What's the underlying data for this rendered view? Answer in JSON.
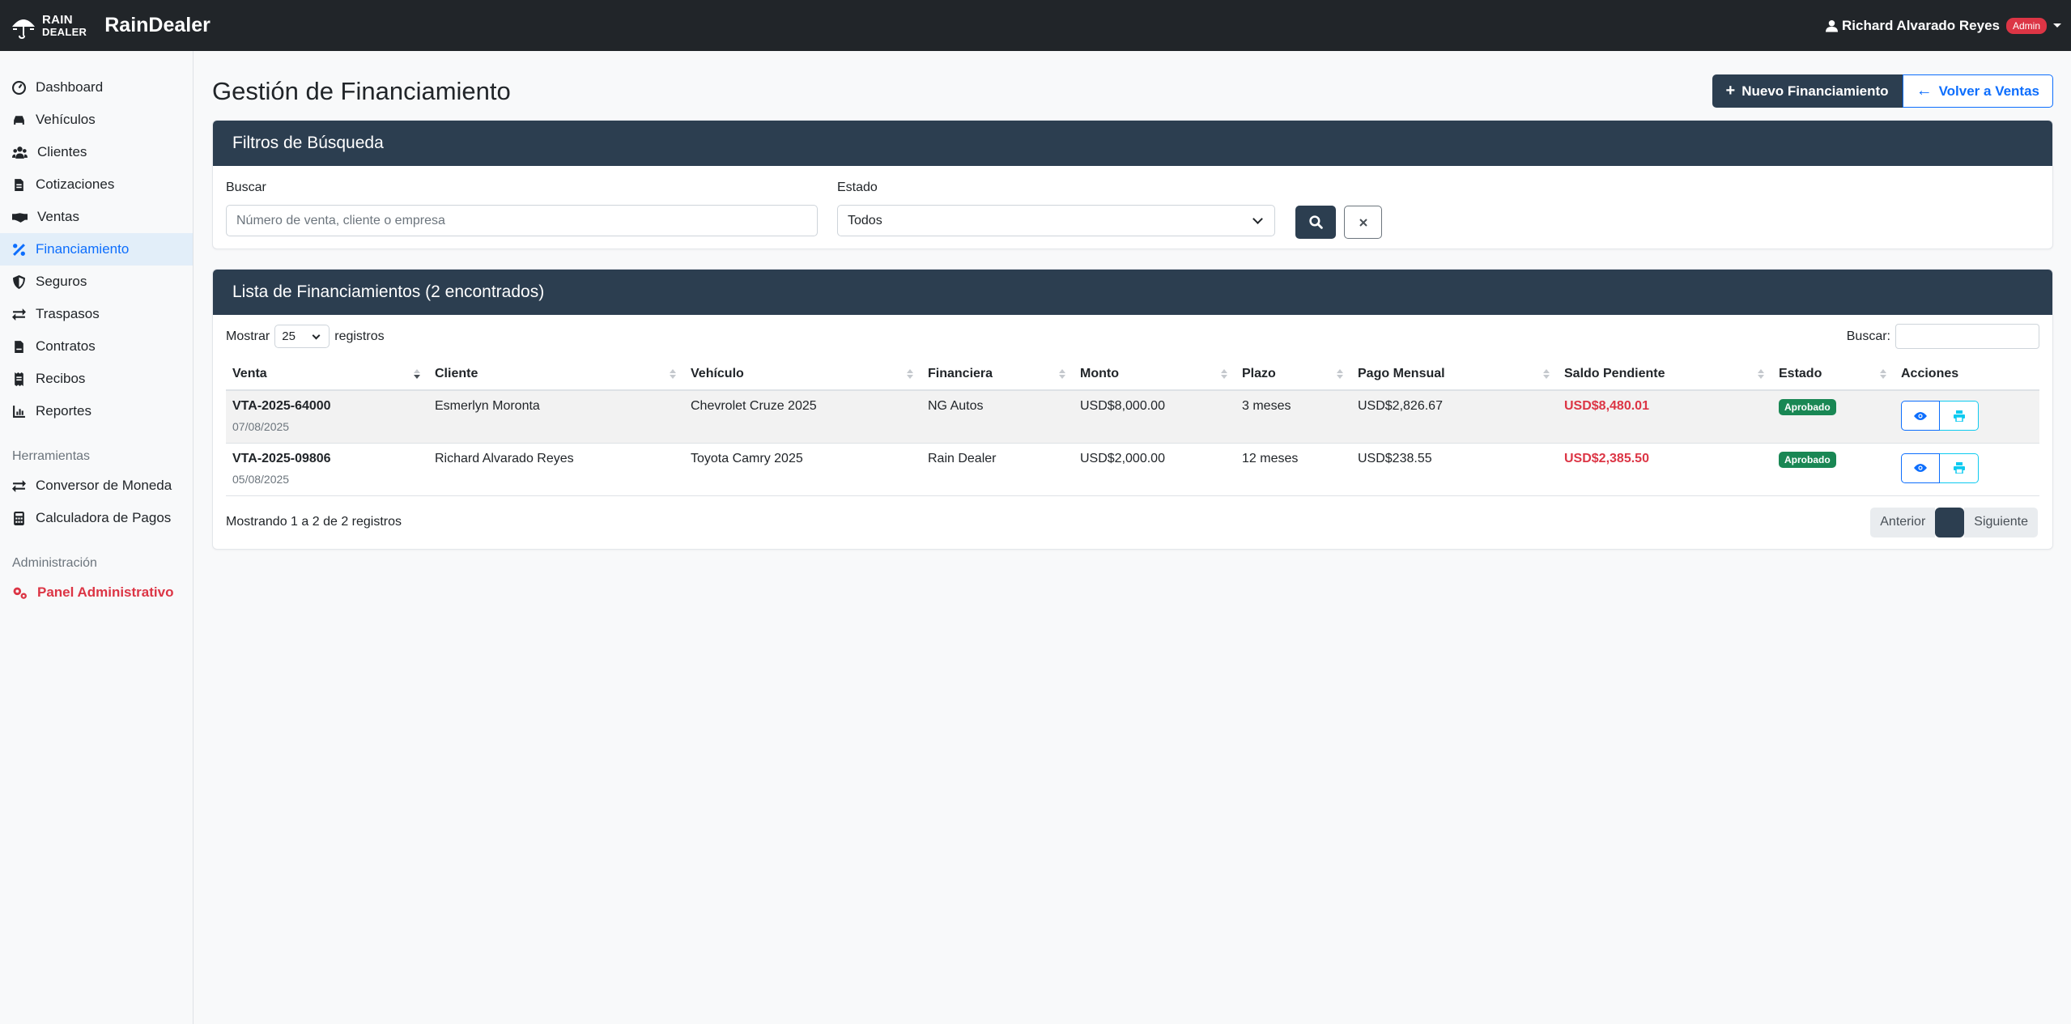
{
  "app": {
    "logo_line1": "RAIN",
    "logo_line2": "DEALER",
    "brand": "RainDealer",
    "user_name": "Richard Alvarado Reyes",
    "user_role": "Admin"
  },
  "sidebar": {
    "items": [
      {
        "label": "Dashboard",
        "icon": "dashboard-icon"
      },
      {
        "label": "Vehículos",
        "icon": "car-icon"
      },
      {
        "label": "Clientes",
        "icon": "users-icon"
      },
      {
        "label": "Cotizaciones",
        "icon": "file-icon"
      },
      {
        "label": "Ventas",
        "icon": "handshake-icon"
      },
      {
        "label": "Financiamiento",
        "icon": "percent-icon",
        "active": true
      },
      {
        "label": "Seguros",
        "icon": "shield-icon"
      },
      {
        "label": "Traspasos",
        "icon": "exchange-icon"
      },
      {
        "label": "Contratos",
        "icon": "file-contract-icon"
      },
      {
        "label": "Recibos",
        "icon": "receipt-icon"
      },
      {
        "label": "Reportes",
        "icon": "chart-icon"
      }
    ],
    "tools_label": "Herramientas",
    "tools": [
      {
        "label": "Conversor de Moneda",
        "icon": "exchange-icon"
      },
      {
        "label": "Calculadora de Pagos",
        "icon": "calculator-icon"
      }
    ],
    "admin_label": "Administración",
    "admin_item": "Panel Administrativo"
  },
  "header": {
    "title": "Gestión de Financiamiento",
    "new_button": "Nuevo Financiamiento",
    "back_button": "Volver a Ventas"
  },
  "filters": {
    "title": "Filtros de Búsqueda",
    "search_label": "Buscar",
    "search_placeholder": "Número de venta, cliente o empresa",
    "status_label": "Estado",
    "status_value": "Todos"
  },
  "list": {
    "title": "Lista de Financiamientos (2 encontrados)",
    "show_label": "Mostrar",
    "page_size": "25",
    "records_label": "registros",
    "search_label": "Buscar:",
    "columns": [
      "Venta",
      "Cliente",
      "Vehículo",
      "Financiera",
      "Monto",
      "Plazo",
      "Pago Mensual",
      "Saldo Pendiente",
      "Estado",
      "Acciones"
    ],
    "rows": [
      {
        "venta": "VTA-2025-64000",
        "fecha": "07/08/2025",
        "cliente": "Esmerlyn Moronta",
        "vehiculo": "Chevrolet Cruze 2025",
        "financiera": "NG Autos",
        "monto": "USD$8,000.00",
        "plazo": "3 meses",
        "pago": "USD$2,826.67",
        "saldo": "USD$8,480.01",
        "estado": "Aprobado"
      },
      {
        "venta": "VTA-2025-09806",
        "fecha": "05/08/2025",
        "cliente": "Richard Alvarado Reyes",
        "vehiculo": "Toyota Camry 2025",
        "financiera": "Rain Dealer",
        "monto": "USD$2,000.00",
        "plazo": "12 meses",
        "pago": "USD$238.55",
        "saldo": "USD$2,385.50",
        "estado": "Aprobado"
      }
    ],
    "info": "Mostrando 1 a 2 de 2 registros",
    "prev": "Anterior",
    "next": "Siguiente"
  },
  "colors": {
    "header_dark": "#2c3e50",
    "accent": "#0d6efd",
    "danger": "#dc3545",
    "success": "#198754"
  }
}
